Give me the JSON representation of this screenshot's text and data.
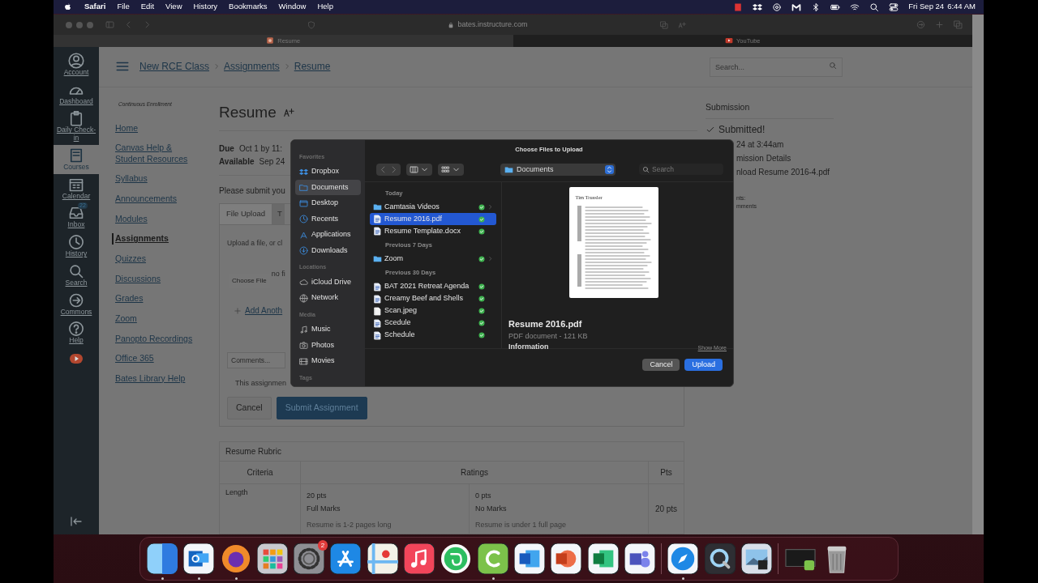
{
  "menu_bar": {
    "app": "Safari",
    "menus": [
      "File",
      "Edit",
      "View",
      "History",
      "Bookmarks",
      "Window",
      "Help"
    ],
    "date": "Fri Sep 24",
    "time": "6:44 AM"
  },
  "browser": {
    "address": "bates.instructure.com",
    "tabs": [
      {
        "label": "Resume",
        "selected": true
      },
      {
        "label": "YouTube",
        "selected": false
      }
    ]
  },
  "global_nav": {
    "items": [
      {
        "label": "Account",
        "selected": false
      },
      {
        "label": "Dashboard",
        "selected": false
      },
      {
        "label": "Daily Check-in",
        "selected": false
      },
      {
        "label": "Courses",
        "selected": true
      },
      {
        "label": "Calendar",
        "selected": false
      },
      {
        "label": "Inbox",
        "selected": false,
        "badge": "22"
      },
      {
        "label": "History",
        "selected": false
      },
      {
        "label": "Search",
        "selected": false
      },
      {
        "label": "Commons",
        "selected": false
      },
      {
        "label": "Help",
        "selected": false
      }
    ]
  },
  "breadcrumb": [
    "New RCE Class",
    "Assignments",
    "Resume"
  ],
  "search": {
    "placeholder": "Search..."
  },
  "course_nav": {
    "term": "Continuous Enrollment",
    "items": [
      {
        "label": "Home",
        "selected": false
      },
      {
        "label": "Canvas Help & Student Resources",
        "selected": false
      },
      {
        "label": "Syllabus",
        "selected": false
      },
      {
        "label": "Announcements",
        "selected": false
      },
      {
        "label": "Modules",
        "selected": false
      },
      {
        "label": "Assignments",
        "selected": true
      },
      {
        "label": "Quizzes",
        "selected": false
      },
      {
        "label": "Discussions",
        "selected": false
      },
      {
        "label": "Grades",
        "selected": false
      },
      {
        "label": "Zoom",
        "selected": false
      },
      {
        "label": "Panopto Recordings",
        "selected": false
      },
      {
        "label": "Office 365",
        "selected": false
      },
      {
        "label": "Bates Library Help",
        "selected": false
      }
    ]
  },
  "assignment": {
    "title": "Resume",
    "due_label": "Due",
    "due": "Oct 1 by 11:",
    "available_label": "Available",
    "available": "Sep 24",
    "instructions": "Please submit you",
    "tabs": [
      {
        "label": "File Upload",
        "selected": true
      },
      {
        "label": "T",
        "selected": false
      }
    ],
    "upload_hint": "Upload a file, or cl",
    "choose_file": "Choose File",
    "no_file": "no fi",
    "add_another": "Add Anoth",
    "comments_placeholder": "Comments...",
    "group_note": "This assignmen",
    "buttons": [
      {
        "label": "Cancel",
        "kind": "secondary"
      },
      {
        "label": "Submit Assignment",
        "kind": "primary"
      }
    ]
  },
  "rubric": {
    "title": "Resume Rubric",
    "columns": [
      "Criteria",
      "Ratings",
      "Pts"
    ],
    "rows": [
      {
        "criterion": "Length",
        "ratings": [
          {
            "points": "20 pts",
            "title": "Full Marks",
            "description": "Resume is 1-2 pages long"
          },
          {
            "points": "0 pts",
            "title": "No Marks",
            "description": "Resume is under 1 full page"
          }
        ],
        "points": "20 pts"
      }
    ]
  },
  "submission": {
    "heading": "Submission",
    "status": "Submitted!",
    "date": "24 at 3:44am",
    "details_link": "mission Details",
    "download_link": "nload Resume 2016-4.pdf",
    "comments_label": "nts:",
    "comments": "mments"
  },
  "file_dialog": {
    "title": "Choose Files to Upload",
    "sidebar": [
      {
        "heading": "Favorites",
        "items": [
          {
            "label": "Dropbox",
            "selected": false
          },
          {
            "label": "Documents",
            "selected": true
          },
          {
            "label": "Desktop",
            "selected": false
          },
          {
            "label": "Recents",
            "selected": false
          },
          {
            "label": "Applications",
            "selected": false
          },
          {
            "label": "Downloads",
            "selected": false
          }
        ]
      },
      {
        "heading": "Locations",
        "items": [
          {
            "label": "iCloud Drive",
            "selected": false
          },
          {
            "label": "Network",
            "selected": false
          }
        ]
      },
      {
        "heading": "Media",
        "items": [
          {
            "label": "Music",
            "selected": false
          },
          {
            "label": "Photos",
            "selected": false
          },
          {
            "label": "Movies",
            "selected": false
          }
        ]
      },
      {
        "heading": "Tags"
      }
    ],
    "location": "Documents",
    "search_placeholder": "Search",
    "groups": [
      {
        "heading": "Today",
        "files": [
          {
            "name": "Camtasia Videos",
            "kind": "folder",
            "selected": false
          },
          {
            "name": "Resume 2016.pdf",
            "kind": "document",
            "selected": true
          },
          {
            "name": "Resume Template.docx",
            "kind": "document",
            "selected": false
          }
        ]
      },
      {
        "heading": "Previous 7 Days",
        "files": [
          {
            "name": "Zoom",
            "kind": "folder",
            "selected": false
          }
        ]
      },
      {
        "heading": "Previous 30 Days",
        "files": [
          {
            "name": "BAT 2021 Retreat Agenda",
            "kind": "document",
            "selected": false
          },
          {
            "name": "Creamy Beef and Shells",
            "kind": "document",
            "selected": false
          },
          {
            "name": "Scan.jpeg",
            "kind": "image",
            "selected": false
          },
          {
            "name": "Scedule",
            "kind": "document",
            "selected": false
          },
          {
            "name": "Schedule",
            "kind": "document",
            "selected": false
          }
        ]
      }
    ],
    "preview": {
      "doc_heading": "Tim Trussler",
      "name": "Resume 2016.pdf",
      "info": "PDF document - 121 KB",
      "section": "Information",
      "more": "Show More"
    },
    "buttons": [
      {
        "label": "Cancel",
        "kind": "secondary"
      },
      {
        "label": "Upload",
        "kind": "primary"
      }
    ]
  },
  "dock": {
    "apps": [
      {
        "running": true
      },
      {
        "running": true
      },
      {
        "running": true
      },
      {
        "running": false
      },
      {
        "running": false,
        "badge": "2"
      },
      {
        "running": false
      },
      {
        "running": false
      },
      {
        "running": false
      },
      {
        "running": false
      },
      {
        "running": true
      },
      {
        "running": false
      },
      {
        "running": false
      },
      {
        "running": false
      },
      {
        "running": false
      },
      {
        "running": true
      },
      {
        "running": false
      },
      {
        "running": false
      },
      {
        "running": false
      },
      {
        "running": false
      }
    ]
  }
}
